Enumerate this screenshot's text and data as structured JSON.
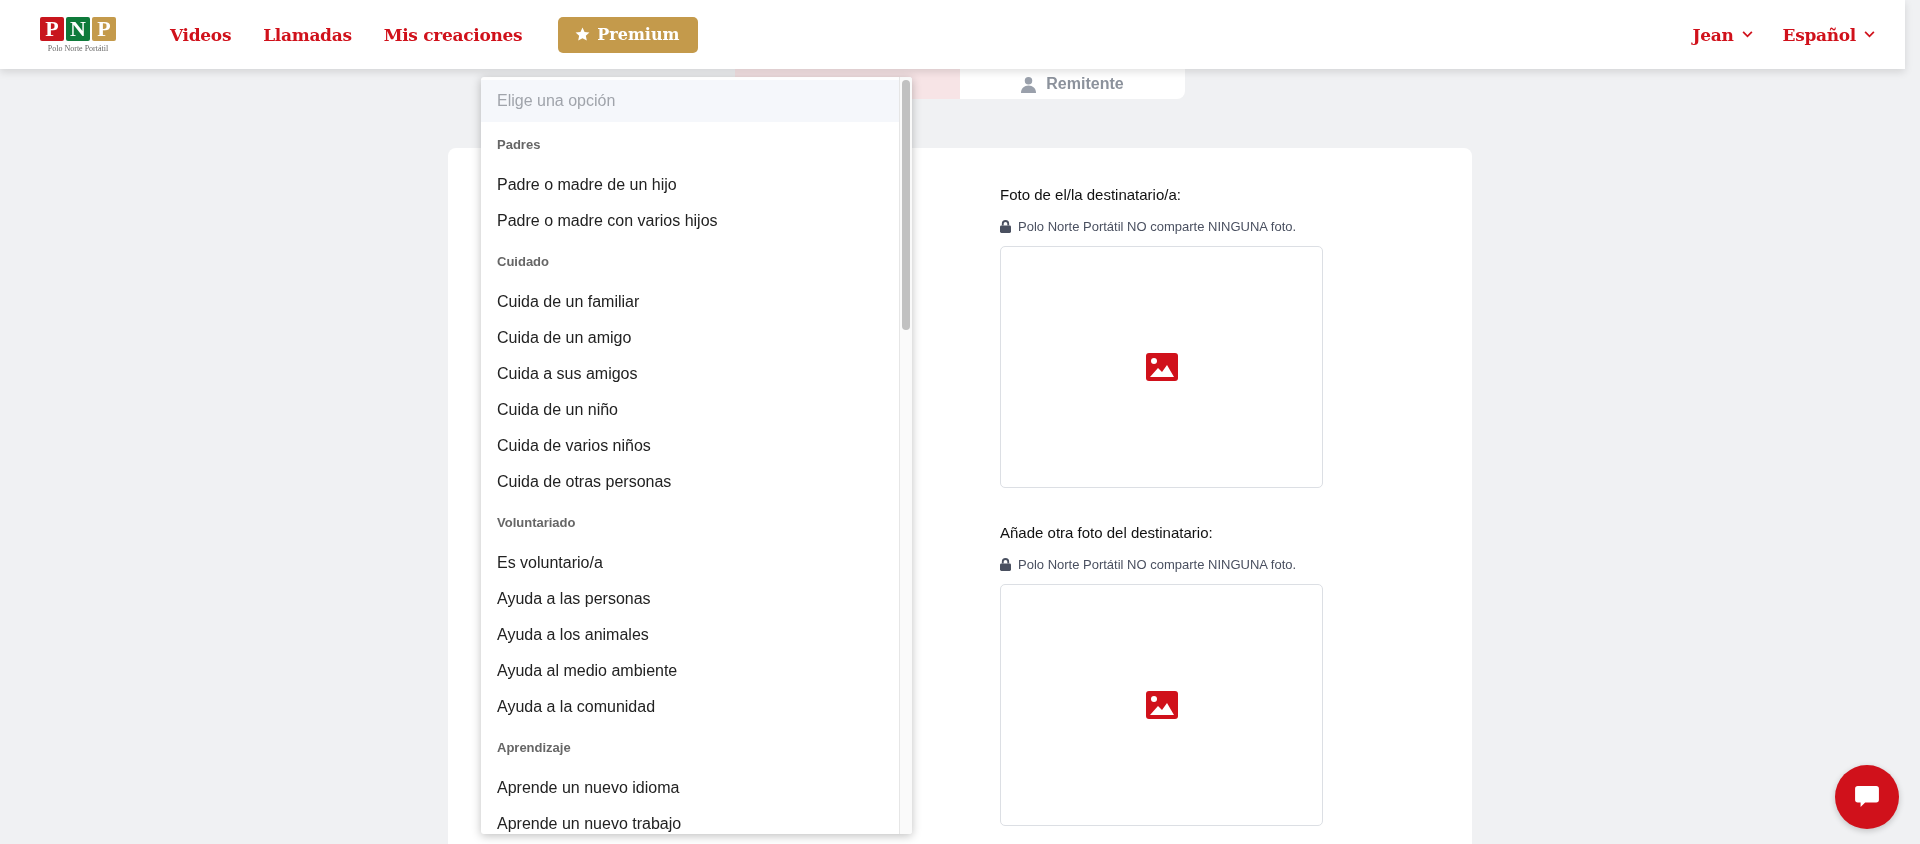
{
  "header": {
    "logo": {
      "letters": [
        {
          "char": "P",
          "color": "#c8151d"
        },
        {
          "char": "N",
          "color": "#0e7a3a"
        },
        {
          "char": "P",
          "color": "#c49a4b"
        }
      ],
      "caption": "Polo Norte Portátil"
    },
    "nav": [
      {
        "label": "Videos"
      },
      {
        "label": "Llamadas"
      },
      {
        "label": "Mis creaciones"
      }
    ],
    "premium": "Premium",
    "user_menu": "Jean",
    "language_menu": "Español"
  },
  "tabs": [
    {
      "selected": true
    },
    {
      "label": "Remitente",
      "selected": false
    }
  ],
  "dropdown": {
    "placeholder": "Elige una opción",
    "groups": [
      {
        "label": "Padres",
        "options": [
          "Padre o madre de un hijo",
          "Padre o madre con varios hijos"
        ]
      },
      {
        "label": "Cuidado",
        "options": [
          "Cuida de un familiar",
          "Cuida de un amigo",
          "Cuida a sus amigos",
          "Cuida de un niño",
          "Cuida de varios niños",
          "Cuida de otras personas"
        ]
      },
      {
        "label": "Voluntariado",
        "options": [
          "Es voluntario/a",
          "Ayuda a las personas",
          "Ayuda a los animales",
          "Ayuda al medio ambiente",
          "Ayuda a la comunidad"
        ]
      },
      {
        "label": "Aprendizaje",
        "options": [
          "Aprende un nuevo idioma",
          "Aprende un nuevo trabajo"
        ]
      }
    ]
  },
  "photos": [
    {
      "label": "Foto de el/la destinatario/a:",
      "note": "Polo Norte Portátil NO comparte NINGUNA foto."
    },
    {
      "label": "Añade otra foto del destinatario:",
      "note": "Polo Norte Portátil NO comparte NINGUNA foto."
    }
  ]
}
